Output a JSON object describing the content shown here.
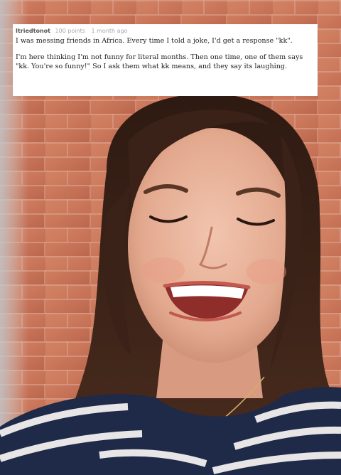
{
  "post": {
    "username": "Itriedtonot",
    "points": "100 points",
    "time": "1 month ago",
    "paragraph1": "I was messing friends in Africa. Every time I told a joke, I'd get a response \"kk\".",
    "paragraph2": "I'm here thinking I'm not funny for literal months. Then one time, one of them says \"kk. You're so funny!\" So I ask them what kk means, and they say its laughing."
  },
  "photo": {
    "subject": "smiling woman with eyes closed",
    "colors": {
      "brick": "#c56a4c",
      "hair": "#3a2218",
      "skin": "#e8b49c",
      "shirt_navy": "#1e2a48",
      "shirt_stripe": "#f2f0ee"
    }
  }
}
